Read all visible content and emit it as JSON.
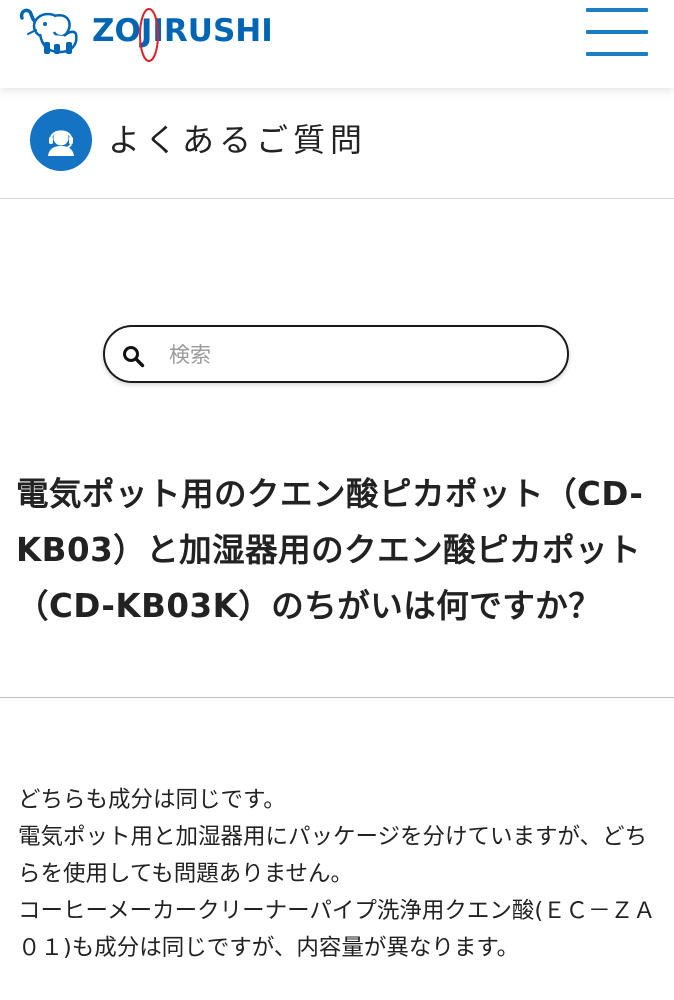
{
  "header": {
    "logo_text": "ZOJIRUSHI",
    "logo_icon": "elephant-icon",
    "menu_icon": "hamburger-menu-icon",
    "brand_color": "#0066b3",
    "accent_color": "#1d7dc2"
  },
  "section": {
    "icon": "support-headset-icon",
    "title": "よくあるご質問"
  },
  "search": {
    "icon": "search-icon",
    "placeholder": "検索",
    "value": ""
  },
  "question": {
    "title": "電気ポット用のクエン酸ピカポット（CD-KB03）と加湿器用のクエン酸ピカポット（CD-KB03K）のちがいは何ですか？"
  },
  "answer": {
    "lines": [
      "どちらも成分は同じです。",
      "電気ポット用と加湿器用にパッケージを分けていますが、どちらを使用しても問題ありません。",
      "コーヒーメーカークリーナーパイプ洗浄用クエン酸(ＥＣ－ＺＡ０１)も成分は同じですが、内容量が異なります。"
    ]
  }
}
